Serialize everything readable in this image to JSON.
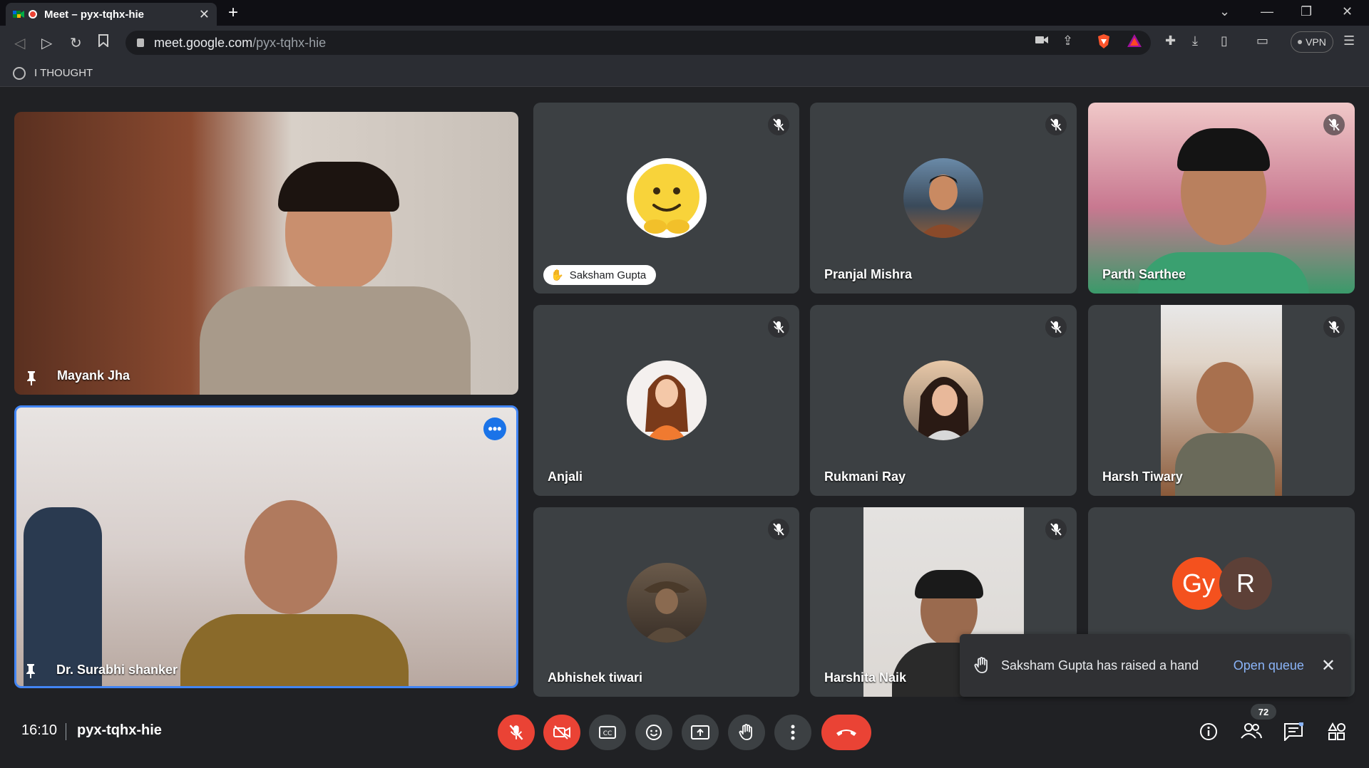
{
  "browser": {
    "tab_title": "Meet – pyx-tqhx-hie",
    "new_tab": "+",
    "url_host": "meet.google.com",
    "url_path": "/pyx-tqhx-hie",
    "vpn_label": "VPN",
    "bookmark": "I THOUGHT"
  },
  "tiles": {
    "mayank": "Mayank Jha",
    "surabhi": "Dr. Surabhi shanker",
    "saksham": "Saksham Gupta",
    "pranjal": "Pranjal Mishra",
    "parth": "Parth Sarthee",
    "anjali": "Anjali",
    "rukmani": "Rukmani Ray",
    "harsh": "Harsh Tiwary",
    "abhishek": "Abhishek tiwari",
    "harshita": "Harshita Naik",
    "gy": "Gy",
    "r": "R"
  },
  "bottom": {
    "time": "16:10",
    "code": "pyx-tqhx-hie",
    "participants_count": "72"
  },
  "toast": {
    "message": "Saksham Gupta has raised a hand",
    "action": "Open queue"
  },
  "colors": {
    "red": "#ea4335",
    "tile": "#3c4043",
    "bg": "#202124",
    "link": "#8ab4f8",
    "highlight": "#4285f4"
  }
}
